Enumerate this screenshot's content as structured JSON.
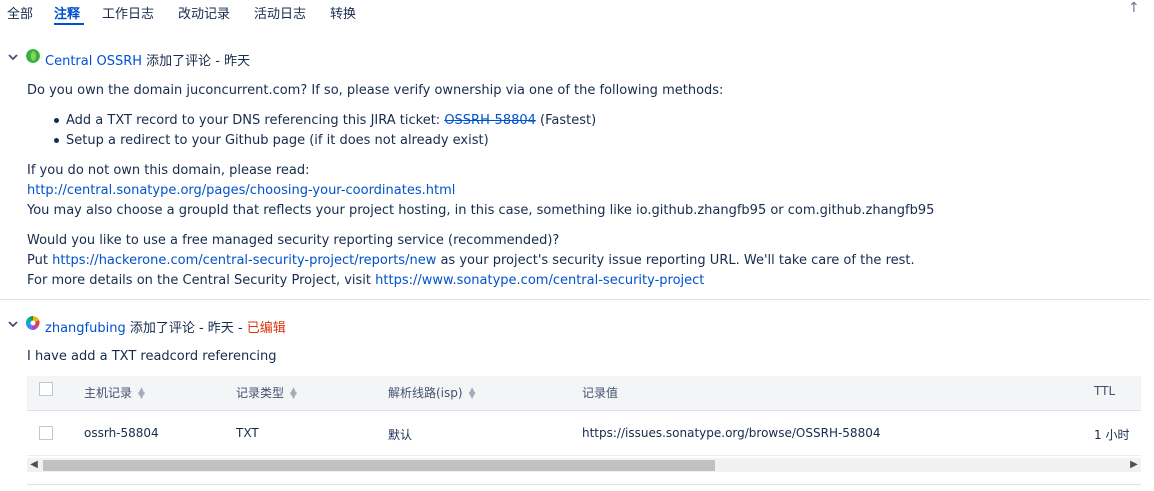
{
  "tabs": [
    {
      "label": "全部"
    },
    {
      "label": "注释"
    },
    {
      "label": "工作日志"
    },
    {
      "label": "改动记录"
    },
    {
      "label": "活动日志"
    },
    {
      "label": "转换"
    }
  ],
  "active_tab_index": 1,
  "top_button_glyph": "↑",
  "comments": [
    {
      "author": "Central OSSRH",
      "action": " 添加了评论 - ",
      "time": "昨天",
      "avatar_icon": "green-leaf-avatar",
      "lines": {
        "p1": "Do you own the domain juconcurrent.com? If so, please verify ownership via one of the following methods:",
        "bullet1_prefix": "Add a TXT record to your DNS referencing this JIRA ticket: ",
        "bullet1_link": "OSSRH-58804",
        "bullet1_suffix": " (Fastest)",
        "bullet2": "Setup a redirect to your Github page (if it does not already exist)",
        "p2": "If you do not own this domain, please read:",
        "p2_link": "http://central.sonatype.org/pages/choosing-your-coordinates.html",
        "p3": "You may also choose a groupId that reflects your project hosting, in this case, something like io.github.zhangfb95 or com.github.zhangfb95",
        "p4": "Would you like to use a free managed security reporting service (recommended)?",
        "p5_prefix": "Put ",
        "p5_link": "https://hackerone.com/central-security-project/reports/new",
        "p5_suffix": " as your project's security issue reporting URL. We'll take care of the rest.",
        "p6_prefix": "For more details on the Central Security Project, visit ",
        "p6_link": "https://www.sonatype.com/central-security-project"
      }
    },
    {
      "author": "zhangfubing",
      "action": " 添加了评论 - ",
      "time": "昨天",
      "separator": " - ",
      "edited": "已编辑",
      "avatar_icon": "color-wheel-avatar",
      "text": "I have add a TXT readcord referencing",
      "table": {
        "headers": [
          "主机记录",
          "记录类型",
          "解析线路(isp)",
          "记录值",
          "TTL"
        ],
        "rows": [
          [
            "ossrh-58804",
            "TXT",
            "默认",
            "https://issues.sonatype.org/browse/OSSRH-58804",
            "1 小时"
          ]
        ]
      }
    }
  ],
  "colors": {
    "link": "#0052cc",
    "edited": "#de350b",
    "text": "#172b4d"
  }
}
